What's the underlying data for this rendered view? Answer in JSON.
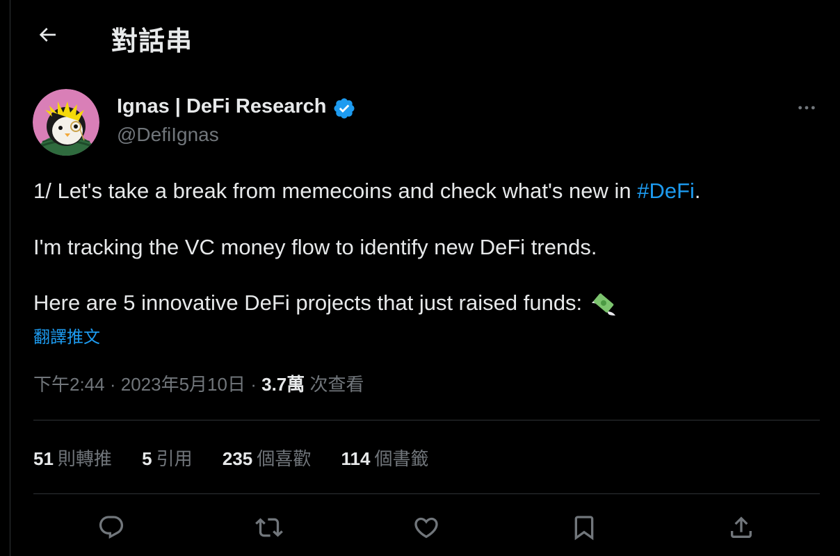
{
  "header": {
    "title": "對話串"
  },
  "author": {
    "name": "Ignas | DeFi Research",
    "handle": "@DefiIgnas"
  },
  "tweet": {
    "line1_before": "1/ Let's take a break from memecoins and check what's new in ",
    "line1_hashtag": "#DeFi",
    "line1_after": ".",
    "line2": "I'm tracking the VC money flow to identify new DeFi trends.",
    "line3": "Here are 5 innovative DeFi projects that just raised funds:",
    "translate_label": "翻譯推文"
  },
  "meta": {
    "time": "下午2:44",
    "date": "2023年5月10日",
    "sep": "·",
    "views_count": "3.7萬",
    "views_label": "次查看"
  },
  "stats": [
    {
      "count": "51",
      "label": "則轉推"
    },
    {
      "count": "5",
      "label": "引用"
    },
    {
      "count": "235",
      "label": "個喜歡"
    },
    {
      "count": "114",
      "label": "個書籤"
    }
  ],
  "colors": {
    "background": "#000000",
    "text": "#e7e9ea",
    "muted": "#71767b",
    "accent": "#1d9bf0",
    "divider": "#2f3336"
  },
  "icons": [
    "back-arrow-icon",
    "verified-badge-icon",
    "more-dots-icon",
    "money-with-wings-icon",
    "reply-icon",
    "retweet-icon",
    "like-icon",
    "bookmark-icon",
    "share-icon"
  ]
}
